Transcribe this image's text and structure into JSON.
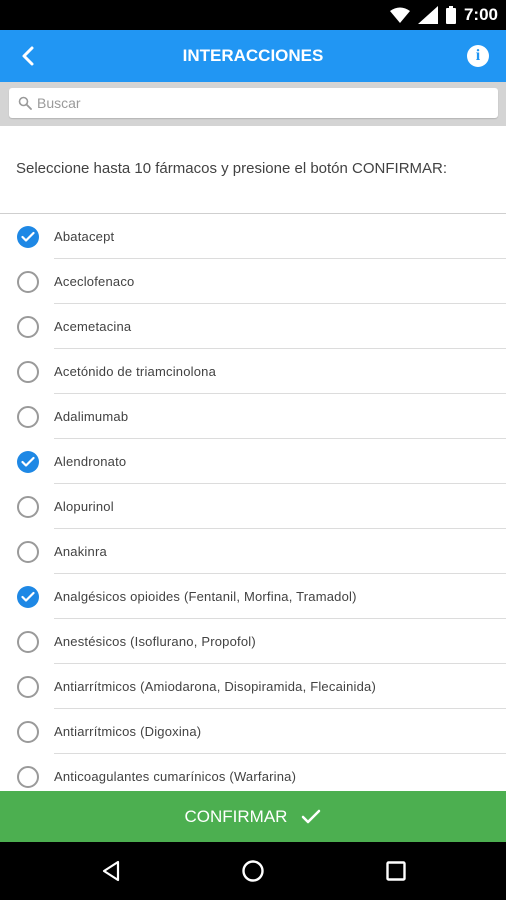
{
  "status_bar": {
    "time": "7:00",
    "network": "LTE"
  },
  "app_bar": {
    "title": "INTERACCIONES",
    "back_icon": "arrow-back-icon",
    "info_icon": "info-icon"
  },
  "search": {
    "placeholder": "Buscar",
    "value": ""
  },
  "instruction": "Seleccione hasta 10 fármacos y presione el botón CONFIRMAR:",
  "items": [
    {
      "label": "Abatacept",
      "checked": true
    },
    {
      "label": "Aceclofenaco",
      "checked": false
    },
    {
      "label": "Acemetacina",
      "checked": false
    },
    {
      "label": "Acetónido de triamcinolona",
      "checked": false
    },
    {
      "label": "Adalimumab",
      "checked": false
    },
    {
      "label": "Alendronato",
      "checked": true
    },
    {
      "label": "Alopurinol",
      "checked": false
    },
    {
      "label": "Anakinra",
      "checked": false
    },
    {
      "label": "Analgésicos opioides (Fentanil, Morfina, Tramadol)",
      "checked": true
    },
    {
      "label": "Anestésicos (Isoflurano, Propofol)",
      "checked": false
    },
    {
      "label": "Antiarrítmicos (Amiodarona, Disopiramida, Flecainida)",
      "checked": false
    },
    {
      "label": "Antiarrítmicos (Digoxina)",
      "checked": false
    },
    {
      "label": "Anticoagulantes cumarínicos (Warfarina)",
      "checked": false
    }
  ],
  "confirm": {
    "label": "CONFIRMAR",
    "icon": "check-icon"
  },
  "colors": {
    "primary": "#2196f3",
    "checked": "#1e88e5",
    "confirm": "#4caf50"
  }
}
